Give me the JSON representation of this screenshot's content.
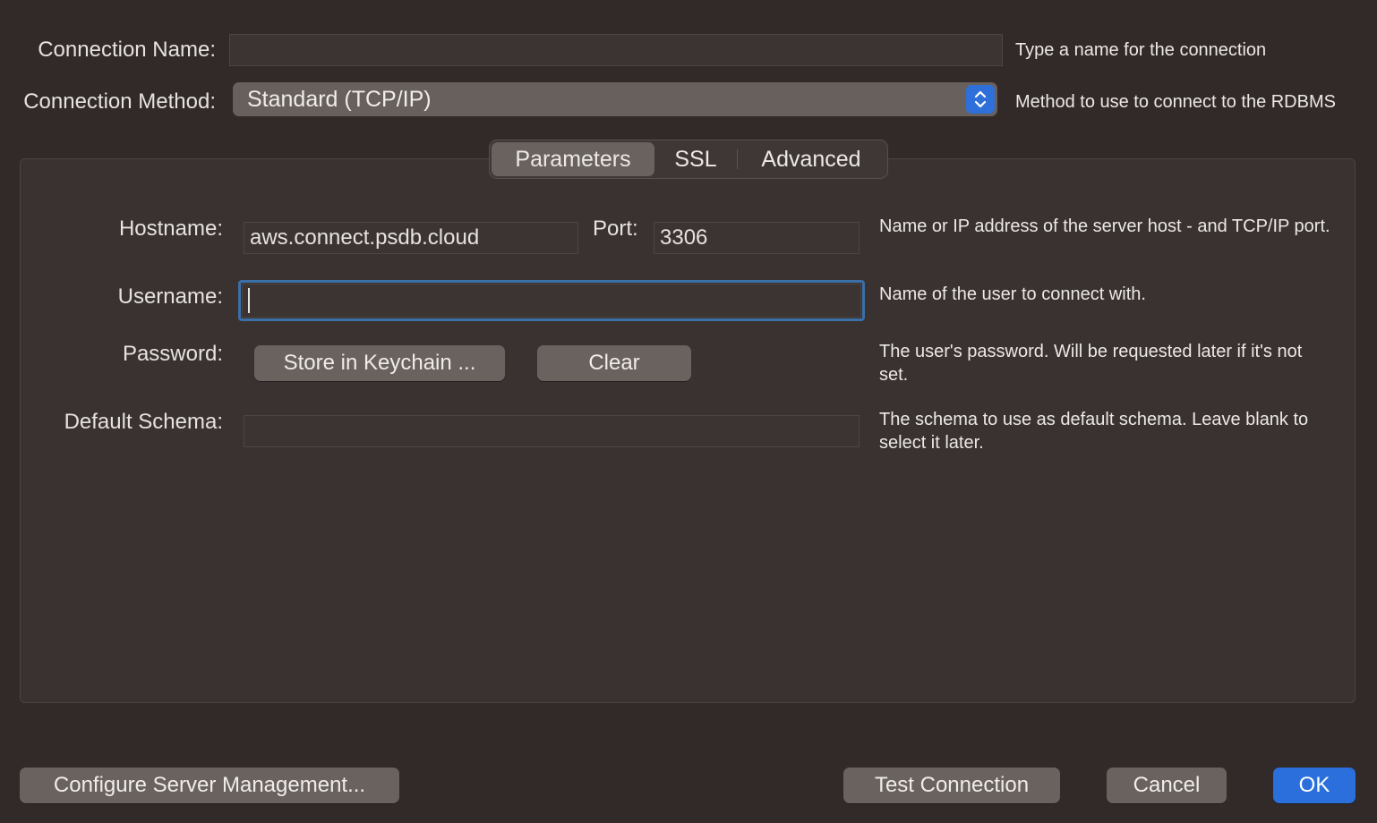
{
  "connection": {
    "name_label": "Connection Name:",
    "name_value": "",
    "name_help": "Type a name for the connection",
    "method_label": "Connection Method:",
    "method_value": "Standard (TCP/IP)",
    "method_help": "Method to use to connect to the RDBMS"
  },
  "tabs": [
    {
      "label": "Parameters",
      "active": true
    },
    {
      "label": "SSL",
      "active": false
    },
    {
      "label": "Advanced",
      "active": false
    }
  ],
  "params": {
    "hostname_label": "Hostname:",
    "hostname_value": "aws.connect.psdb.cloud",
    "port_label": "Port:",
    "port_value": "3306",
    "hostname_help": "Name or IP address of the server host - and TCP/IP port.",
    "username_label": "Username:",
    "username_value": "",
    "username_help": "Name of the user to connect with.",
    "password_label": "Password:",
    "store_keychain_label": "Store in Keychain ...",
    "clear_label": "Clear",
    "password_help": "The user's password. Will be requested later if it's not set.",
    "schema_label": "Default Schema:",
    "schema_value": "",
    "schema_help": "The schema to use as default schema. Leave blank to select it later."
  },
  "footer": {
    "configure_label": "Configure Server Management...",
    "test_label": "Test Connection",
    "cancel_label": "Cancel",
    "ok_label": "OK"
  },
  "colors": {
    "background": "#322a28",
    "panel": "#3a3230",
    "button": "#6a625f",
    "accent": "#2a6fdb",
    "focus_ring": "#3a6fa8"
  },
  "icons": {
    "method_stepper": "up-down-chevron-icon"
  }
}
